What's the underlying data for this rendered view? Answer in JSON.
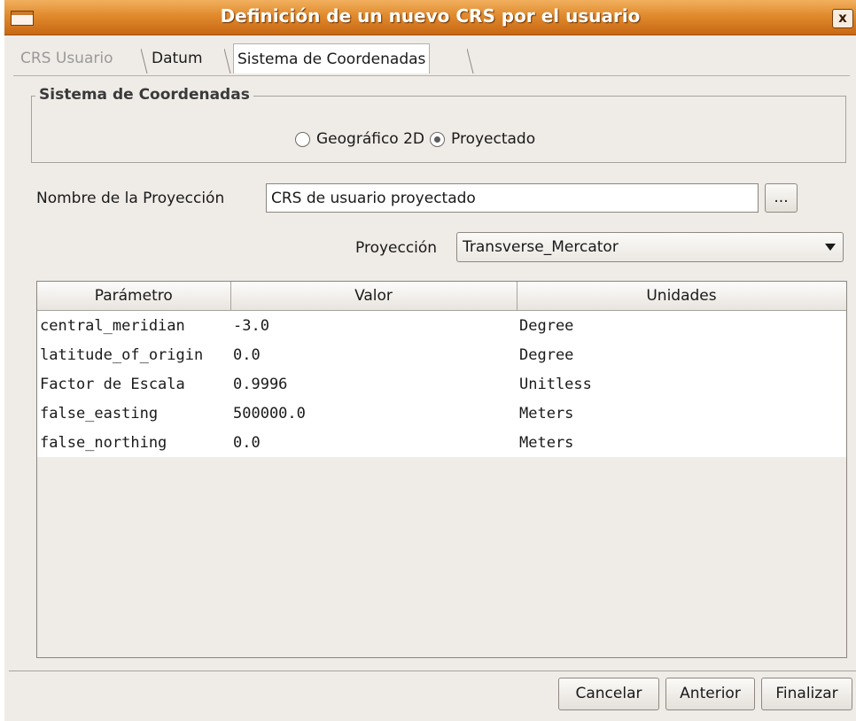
{
  "window": {
    "title": "Definición de un nuevo CRS por el usuario",
    "close_symbol": "x"
  },
  "tabs": [
    {
      "label": "CRS Usuario",
      "state": "disabled"
    },
    {
      "label": "Datum",
      "state": "enabled"
    },
    {
      "label": "Sistema de Coordenadas",
      "state": "selected"
    }
  ],
  "group": {
    "label": "Sistema de Coordenadas",
    "radios": [
      {
        "label": "Geográfico 2D",
        "checked": false
      },
      {
        "label": "Proyectado",
        "checked": true
      }
    ]
  },
  "projection_name": {
    "label": "Nombre de la Proyección",
    "value": "CRS de usuario proyectado",
    "browse_label": "..."
  },
  "projection": {
    "label": "Proyección",
    "selected": "Transverse_Mercator"
  },
  "table": {
    "headers": [
      "Parámetro",
      "Valor",
      "Unidades"
    ],
    "rows": [
      [
        "central_meridian",
        "-3.0",
        "Degree"
      ],
      [
        "latitude_of_origin",
        "0.0",
        "Degree"
      ],
      [
        "Factor de Escala",
        "0.9996",
        "Unitless"
      ],
      [
        "false_easting",
        "500000.0",
        "Meters"
      ],
      [
        "false_northing",
        "0.0",
        "Meters"
      ]
    ]
  },
  "buttons": {
    "cancel": "Cancelar",
    "previous": "Anterior",
    "finish": "Finalizar"
  }
}
